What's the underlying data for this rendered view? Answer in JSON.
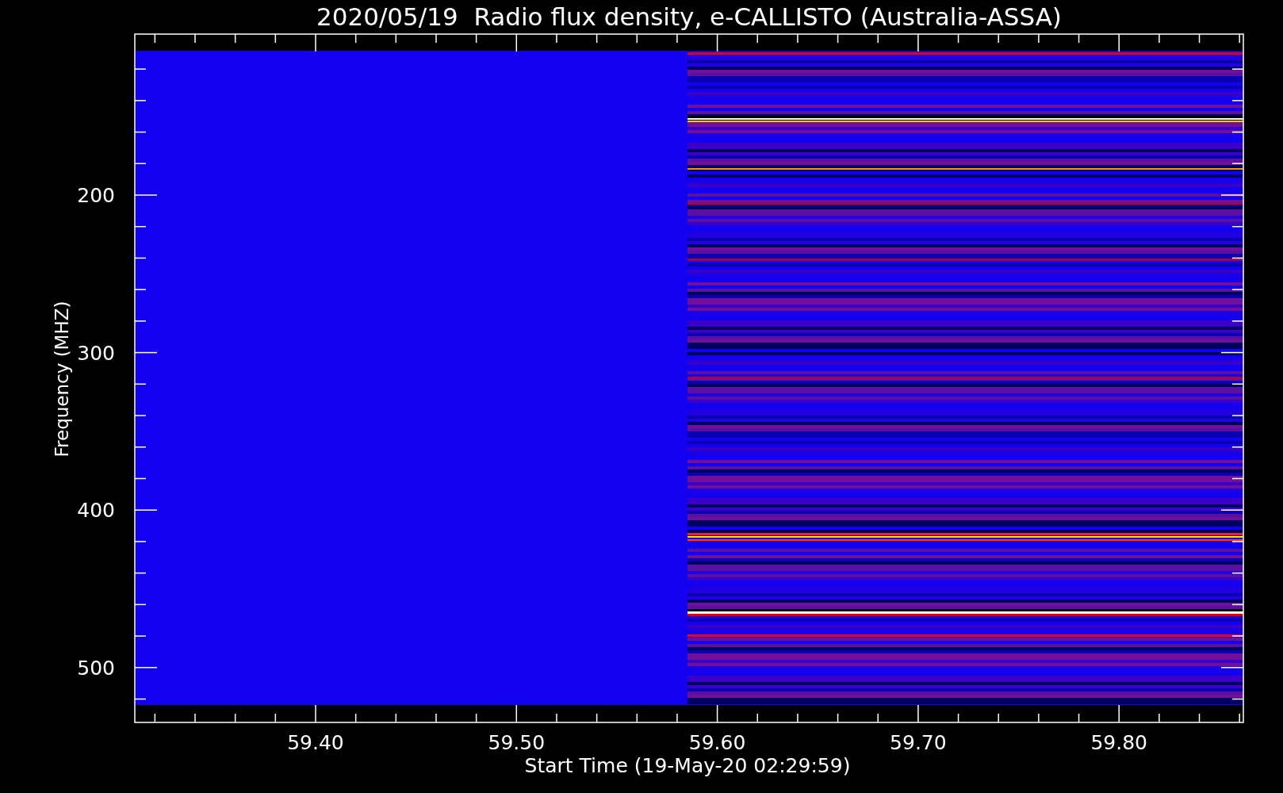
{
  "title": "2020/05/19  Radio flux density, e-CALLISTO (Australia-ASSA)",
  "ylabel": "Frequency (MHZ)",
  "xlabel": "Start Time (19-May-20 02:29:59)",
  "yticks": [
    "200",
    "300",
    "400",
    "500"
  ],
  "xticks": [
    "59.40",
    "59.50",
    "59.60",
    "59.70",
    "59.80"
  ]
}
